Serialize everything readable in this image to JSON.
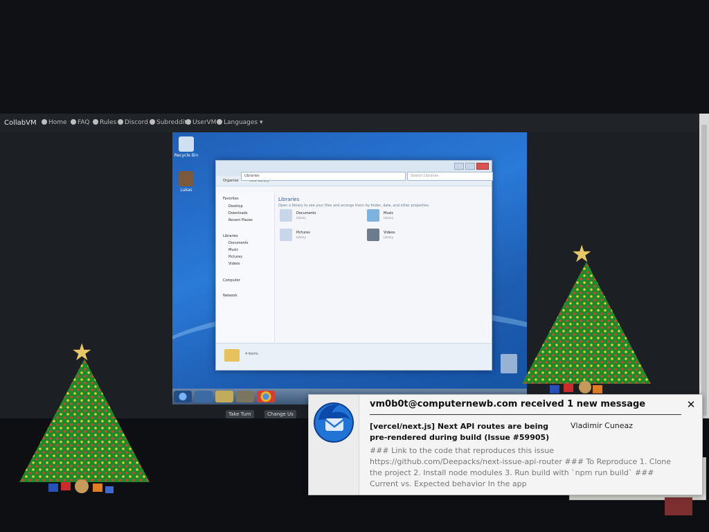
{
  "colors": {
    "desktop_blue": "#2a7ad8",
    "tree_green": "#1f8a2a",
    "star_gold": "#e8c766"
  },
  "browser": {
    "brand": "CollabVM",
    "nav": [
      "Home",
      "FAQ",
      "Rules",
      "Discord",
      "Subreddit",
      "UserVM",
      "Languages"
    ],
    "vm_buttons": [
      "Take Turn",
      "Change Us"
    ]
  },
  "vm": {
    "desktop_icons": [
      {
        "label": "Recycle Bin"
      },
      {
        "label": "Lukas"
      }
    ],
    "explorer": {
      "address": "Libraries",
      "search_placeholder": "Search Libraries",
      "toolbar": [
        "Organize",
        "New library"
      ],
      "nav": [
        "Favorites",
        "Desktop",
        "Downloads",
        "Recent Places",
        "Libraries",
        "Documents",
        "Music",
        "Pictures",
        "Videos",
        "Computer",
        "Network"
      ],
      "title": "Libraries",
      "description": "Open a library to see your files and arrange them by folder, date, and other properties.",
      "items": [
        {
          "name": "Documents",
          "sub": "Library"
        },
        {
          "name": "Music",
          "sub": "Library"
        },
        {
          "name": "Pictures",
          "sub": "Library"
        },
        {
          "name": "Videos",
          "sub": "Library"
        }
      ],
      "status": "4 items"
    }
  },
  "notification": {
    "header": "vm0b0t@computernewb.com received 1 new message",
    "subject": "[vercel/next.js] Next API routes are being pre-rendered during build (Issue #59905)",
    "sender": "Vladimir Cuneaz",
    "preview": "### Link to the code that reproduces this issue https://github.com/Deepacks/next-issue-api-router ### To Reproduce 1. Clone the project 2. Install node modules 3. Run build with `npm run build` ### Current vs. Expected behavior In the app",
    "close_glyph": "✕",
    "app_icon": "thunderbird-icon"
  }
}
